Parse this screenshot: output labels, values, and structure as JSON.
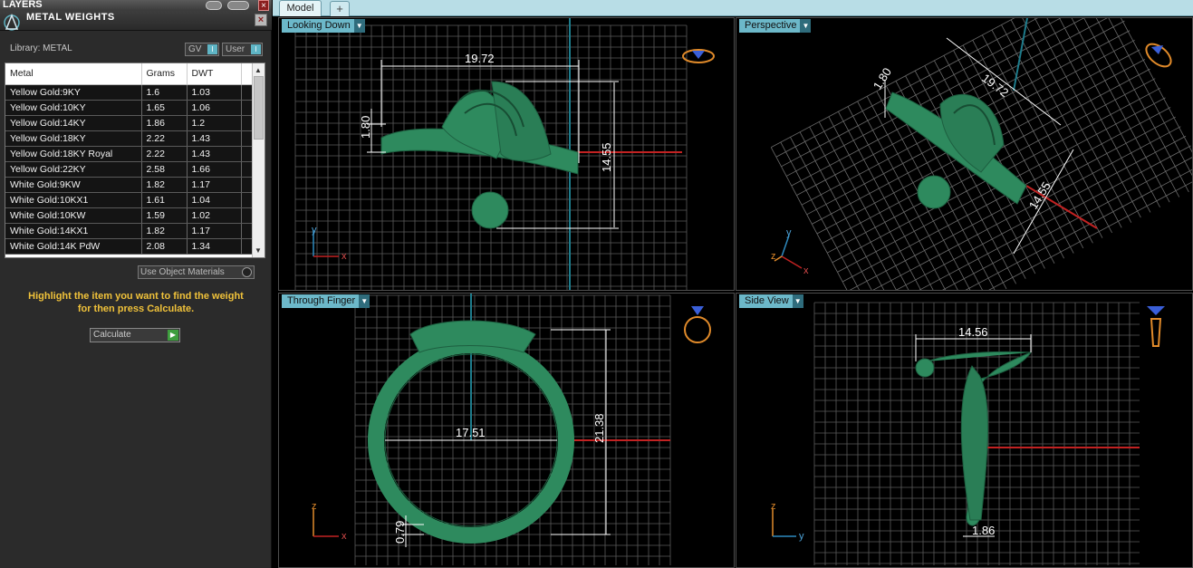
{
  "layers_panel": {
    "title": "LAYERS"
  },
  "metal_weights": {
    "title": "METAL WEIGHTS",
    "library_label": "Library: METAL",
    "gv_button": "GV",
    "user_button": "User",
    "columns": [
      "Metal",
      "Grams",
      "DWT"
    ],
    "rows": [
      [
        "Yellow Gold:9KY",
        "1.6",
        "1.03"
      ],
      [
        "Yellow Gold:10KY",
        "1.65",
        "1.06"
      ],
      [
        "Yellow Gold:14KY",
        "1.86",
        "1.2"
      ],
      [
        "Yellow Gold:18KY",
        "2.22",
        "1.43"
      ],
      [
        "Yellow Gold:18KY Royal",
        "2.22",
        "1.43"
      ],
      [
        "Yellow Gold:22KY",
        "2.58",
        "1.66"
      ],
      [
        "White Gold:9KW",
        "1.82",
        "1.17"
      ],
      [
        "White Gold:10KX1",
        "1.61",
        "1.04"
      ],
      [
        "White Gold:10KW",
        "1.59",
        "1.02"
      ],
      [
        "White Gold:14KX1",
        "1.82",
        "1.17"
      ],
      [
        "White Gold:14K PdW",
        "2.08",
        "1.34"
      ]
    ],
    "use_object_materials": "Use Object Materials",
    "instruction_line1": "Highlight the item you want to find the weight",
    "instruction_line2": "for then press Calculate.",
    "calculate_button": "Calculate"
  },
  "tabs": {
    "model": "Model",
    "add": "+"
  },
  "viewports": {
    "top_left": {
      "label": "Looking Down",
      "dims": {
        "width": "19.72",
        "height_left": "1.80",
        "height_right": "14.55"
      },
      "axes": {
        "vertical": "y",
        "horizontal": "x"
      }
    },
    "top_right": {
      "label": "Perspective",
      "dims": {
        "width": "19.72",
        "left": "1.80",
        "right": "14.55"
      },
      "axes": {
        "vertical": "y",
        "horizontal": "x",
        "third": "z"
      }
    },
    "bottom_left": {
      "label": "Through Finger",
      "dims": {
        "inner": "17.51",
        "height": "21.38",
        "thickness": "0.79"
      },
      "axes": {
        "vertical": "z",
        "horizontal": "x"
      }
    },
    "bottom_right": {
      "label": "Side View",
      "dims": {
        "width": "14.56",
        "shank": "1.86"
      },
      "axes": {
        "vertical": "z",
        "horizontal": "y"
      }
    }
  },
  "colors": {
    "model_green": "#2e8a5e",
    "grid": "#5a5a5a",
    "accent_cyan": "#6cb8c9",
    "instruction": "#f0c23a",
    "axis_red": "#c22222"
  }
}
